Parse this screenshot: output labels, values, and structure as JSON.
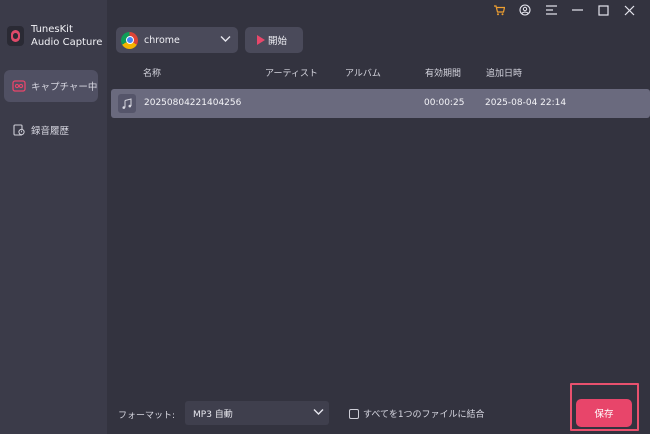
{
  "app": {
    "name_line1": "TunesKit",
    "name_line2": "Audio Capture"
  },
  "sidebar": {
    "items": [
      {
        "label": "キャプチャー中",
        "icon": "capture-icon",
        "active": true
      },
      {
        "label": "録音履歴",
        "icon": "history-icon",
        "active": false
      }
    ]
  },
  "titlebar": {
    "icons": [
      "cart-icon",
      "account-icon",
      "menu-icon",
      "minimize-icon",
      "maximize-icon",
      "close-icon"
    ],
    "cart_color": "#f0a030"
  },
  "toolbar": {
    "source": "chrome",
    "start_label": "開始"
  },
  "table": {
    "columns": [
      "名称",
      "アーティスト",
      "アルバム",
      "有効期間",
      "追加日時"
    ],
    "rows": [
      {
        "name": "20250804221404256",
        "artist": "",
        "album": "",
        "duration": "00:00:25",
        "added": "2025-08-04 22:14"
      }
    ]
  },
  "footer": {
    "format_label": "フォーマット:",
    "format_value": "MP3 自動",
    "merge_label": "すべてを1つのファイルに結合",
    "merge_checked": false,
    "save_label": "保存"
  },
  "colors": {
    "accent": "#e8456a",
    "background": "#33333f",
    "sidebar": "#3b3b49",
    "row_selected": "#6a6a7e"
  }
}
